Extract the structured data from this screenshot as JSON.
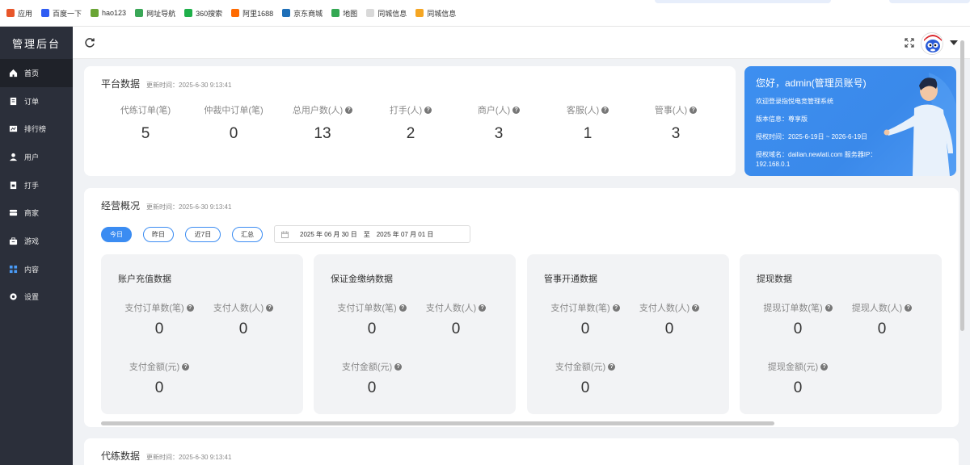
{
  "bookmarks": [
    {
      "label": "应用",
      "icon": "apps-grid-icon",
      "color": "#e8562a"
    },
    {
      "label": "百度一下",
      "icon": "baidu-paw-icon",
      "color": "#2f5cf3"
    },
    {
      "label": "hao123",
      "icon": "hao123-icon",
      "color": "#6aa535"
    },
    {
      "label": "网址导航",
      "icon": "nav-site-icon",
      "color": "#3aa757"
    },
    {
      "label": "360搜索",
      "icon": "360-search-icon",
      "color": "#1fb04a"
    },
    {
      "label": "阿里1688",
      "icon": "ali1688-icon",
      "color": "#ff6a00"
    },
    {
      "label": "京东商城",
      "icon": "jd-icon",
      "color": "#1e6fb8"
    },
    {
      "label": "地图",
      "icon": "map-icon",
      "color": "#34a853"
    },
    {
      "label": "同城信息",
      "icon": "folder-icon",
      "color": "#d9d9d9"
    },
    {
      "label": "同城信息",
      "icon": "star-icon",
      "color": "#f5a623"
    }
  ],
  "sidebar": {
    "title": "管理后台",
    "items": [
      {
        "label": "首页",
        "icon": "home-icon",
        "active": true
      },
      {
        "label": "订单",
        "icon": "order-icon"
      },
      {
        "label": "排行榜",
        "icon": "ranking-icon"
      },
      {
        "label": "用户",
        "icon": "user-icon"
      },
      {
        "label": "打手",
        "icon": "player-icon"
      },
      {
        "label": "商家",
        "icon": "merchant-icon"
      },
      {
        "label": "游戏",
        "icon": "game-bag-icon"
      },
      {
        "label": "内容",
        "icon": "content-grid-icon"
      },
      {
        "label": "设置",
        "icon": "settings-gear-icon"
      }
    ]
  },
  "platform": {
    "title": "平台数据",
    "updated": "更新时间：2025-6-30 9:13:41",
    "stats": [
      {
        "label": "代练订单(笔)",
        "value": "5",
        "help": false
      },
      {
        "label": "仲裁中订单(笔)",
        "value": "0",
        "help": false
      },
      {
        "label": "总用户数(人)",
        "value": "13",
        "help": true
      },
      {
        "label": "打手(人)",
        "value": "2",
        "help": true
      },
      {
        "label": "商户(人)",
        "value": "3",
        "help": true
      },
      {
        "label": "客服(人)",
        "value": "1",
        "help": true
      },
      {
        "label": "管事(人)",
        "value": "3",
        "help": true
      }
    ]
  },
  "welcome": {
    "hello": "您好，admin(管理员账号)",
    "line1": "欢迎登录指悦电竞管理系统",
    "line2": "版本信息：尊享版",
    "line3": "授权时间：2025-6-19日 ~ 2026-6-19日",
    "line4": "授权域名：dailian.newlati.com    服务器IP：",
    "line5": "192.168.0.1",
    "color": "#3b8cf2"
  },
  "overview": {
    "title": "经营概况",
    "updated": "更新时间：2025-6-30 9:13:41",
    "filters": [
      "今日",
      "昨日",
      "近7日",
      "汇总"
    ],
    "active_filter": "今日",
    "date_start": "2025 年 06 月 30 日",
    "date_sep": "至",
    "date_end": "2025 年 07 月 01 日",
    "cards": [
      {
        "title": "账户充值数据",
        "a_label": "支付订单数(笔)",
        "a_value": "0",
        "b_label": "支付人数(人)",
        "b_value": "0",
        "c_label": "支付金额(元)",
        "c_value": "0"
      },
      {
        "title": "保证金缴纳数据",
        "a_label": "支付订单数(笔)",
        "a_value": "0",
        "b_label": "支付人数(人)",
        "b_value": "0",
        "c_label": "支付金额(元)",
        "c_value": "0"
      },
      {
        "title": "管事开通数据",
        "a_label": "支付订单数(笔)",
        "a_value": "0",
        "b_label": "支付人数(人)",
        "b_value": "0",
        "c_label": "支付金额(元)",
        "c_value": "0"
      },
      {
        "title": "提现数据",
        "a_label": "提现订单数(笔)",
        "a_value": "0",
        "b_label": "提现人数(人)",
        "b_value": "0",
        "c_label": "提现金额(元)",
        "c_value": "0"
      }
    ]
  },
  "training": {
    "title": "代练数据",
    "updated": "更新时间：2025-6-30 9:13:41"
  }
}
